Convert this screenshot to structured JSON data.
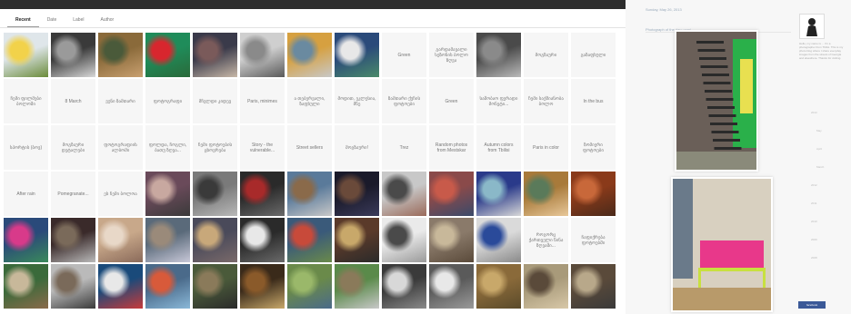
{
  "archive": {
    "tabs": [
      {
        "label": "Recent",
        "active": true
      },
      {
        "label": "Date",
        "active": false
      },
      {
        "label": "Label",
        "active": false
      },
      {
        "label": "Author",
        "active": false
      }
    ],
    "rows": [
      [
        {
          "kind": "photo",
          "colors": [
            "#dfe6ea",
            "#f2d24a",
            "#6b8c3a"
          ]
        },
        {
          "kind": "photo",
          "colors": [
            "#3a3a3a",
            "#9a9a9a",
            "#d8d8d8"
          ]
        },
        {
          "kind": "photo",
          "colors": [
            "#8a6a3a",
            "#4a5a3a",
            "#c9a070"
          ]
        },
        {
          "kind": "photo",
          "colors": [
            "#1f8c5a",
            "#d8262e",
            "#2a6a3a"
          ]
        },
        {
          "kind": "photo",
          "colors": [
            "#3a3a4a",
            "#7a5a5a",
            "#c8b8a8"
          ]
        },
        {
          "kind": "photo",
          "colors": [
            "#cfcfcf",
            "#8a8a8a",
            "#5a5a5a"
          ]
        },
        {
          "kind": "photo",
          "colors": [
            "#d6a040",
            "#6a8aa0",
            "#c8c8c8"
          ]
        },
        {
          "kind": "photo",
          "colors": [
            "#2a4a7a",
            "#e8e8e8",
            "#4a8a6a"
          ]
        },
        {
          "kind": "text",
          "text": "Green"
        },
        {
          "kind": "text",
          "text": "გარდამავალი სეზონის ბოლო ზღვა"
        },
        {
          "kind": "photo",
          "colors": [
            "#4a4a4a",
            "#8a8a8a",
            "#bababa"
          ]
        },
        {
          "kind": "text",
          "text": "მოგზაური"
        },
        {
          "kind": "text",
          "text": "გაზაფხული"
        }
      ],
      [
        {
          "kind": "text",
          "text": "ჩემი ფილმები ბოლოში"
        },
        {
          "kind": "text",
          "text": "8 March"
        },
        {
          "kind": "text",
          "text": "ვენი ზამთარი"
        },
        {
          "kind": "text",
          "text": "ფოტოგრაფი"
        },
        {
          "kind": "text",
          "text": "მჩვლდი კიდევ"
        },
        {
          "kind": "text",
          "text": "Paris, minimes"
        },
        {
          "kind": "text",
          "text": "ა თებერვალი, ზაფხული"
        },
        {
          "kind": "text",
          "text": "მოდით, ეკლესია, მწე"
        },
        {
          "kind": "text",
          "text": "ზამთარი ქუჩის ფოტოები"
        },
        {
          "kind": "text",
          "text": "Green"
        },
        {
          "kind": "text",
          "text": "საშობაო ფერადი მონეტი..."
        },
        {
          "kind": "text",
          "text": "ჩემი საქმიანობა ბოლო"
        },
        {
          "kind": "text",
          "text": "In the bus"
        }
      ],
      [
        {
          "kind": "text",
          "text": "სპორტის (ბოვ)"
        },
        {
          "kind": "text",
          "text": "მოგზაური დეტალები"
        },
        {
          "kind": "text",
          "text": "ფოტოგრაფიის ალბომი"
        },
        {
          "kind": "text",
          "text": "ფოლდა, ჩოგლი, ბათუ ზღვა..."
        },
        {
          "kind": "text",
          "text": "ჩემი ფოტოების ცხოვრება"
        },
        {
          "kind": "text",
          "text": "Story - the vulnerable..."
        },
        {
          "kind": "text",
          "text": "Street sellers"
        },
        {
          "kind": "text",
          "text": "მოგზაური!"
        },
        {
          "kind": "text",
          "text": "Trez"
        },
        {
          "kind": "text",
          "text": "Random photos from Mestskar"
        },
        {
          "kind": "text",
          "text": "Autumn colors from Tbilisi"
        },
        {
          "kind": "text",
          "text": "Paris in color"
        },
        {
          "kind": "text",
          "text": "ზომიერი ფოტოები"
        }
      ],
      [
        {
          "kind": "text",
          "text": "After rain"
        },
        {
          "kind": "text",
          "text": "Pomegranate..."
        },
        {
          "kind": "text",
          "text": "ეს ჩემი ბოლოა"
        },
        {
          "kind": "photo",
          "colors": [
            "#6a4a5a",
            "#c8a8a0",
            "#3a3a3a"
          ]
        },
        {
          "kind": "photo",
          "colors": [
            "#7a7a7a",
            "#3a3a3a",
            "#b8b8b8"
          ]
        },
        {
          "kind": "photo",
          "colors": [
            "#2a2a2a",
            "#a82a2a",
            "#6a6a6a"
          ]
        },
        {
          "kind": "photo",
          "colors": [
            "#5a7a9a",
            "#8a6a4a",
            "#c8c8c8"
          ]
        },
        {
          "kind": "photo",
          "colors": [
            "#1a1a2a",
            "#6a4a3a",
            "#3a3a5a"
          ]
        },
        {
          "kind": "photo",
          "colors": [
            "#c8c8c8",
            "#4a4a4a",
            "#9a6a5a"
          ]
        },
        {
          "kind": "photo",
          "colors": [
            "#8a4a4a",
            "#c85a4a",
            "#3a4a6a"
          ]
        },
        {
          "kind": "photo",
          "colors": [
            "#2a3a8a",
            "#8ab8c8",
            "#d8d8d8"
          ]
        },
        {
          "kind": "photo",
          "colors": [
            "#a87a3a",
            "#5a7a5a",
            "#e8c89a"
          ]
        },
        {
          "kind": "photo",
          "colors": [
            "#8a3a1a",
            "#c8683a",
            "#4a2a1a"
          ]
        }
      ],
      [
        {
          "kind": "photo",
          "colors": [
            "#2a4a7a",
            "#d83a8a",
            "#3a8a5a"
          ]
        },
        {
          "kind": "photo",
          "colors": [
            "#3a2a2a",
            "#7a6a5a",
            "#bababa"
          ]
        },
        {
          "kind": "photo",
          "colors": [
            "#c8a88a",
            "#e8d8c8",
            "#8a6a5a"
          ]
        },
        {
          "kind": "photo",
          "colors": [
            "#5a6a7a",
            "#9a8a7a",
            "#c8c8d8"
          ]
        },
        {
          "kind": "photo",
          "colors": [
            "#4a4a5a",
            "#c8a87a",
            "#7a6a6a"
          ]
        },
        {
          "kind": "photo",
          "colors": [
            "#2a2a2a",
            "#e8e8e8",
            "#6a6a6a"
          ]
        },
        {
          "kind": "photo",
          "colors": [
            "#3a5a7a",
            "#c84a3a",
            "#6a8a4a"
          ]
        },
        {
          "kind": "photo",
          "colors": [
            "#5a3a2a",
            "#c8a86a",
            "#2a2a2a"
          ]
        },
        {
          "kind": "photo",
          "colors": [
            "#eaeaea",
            "#4a4a4a",
            "#9a9a9a"
          ]
        },
        {
          "kind": "photo",
          "colors": [
            "#8a7a6a",
            "#c8b89a",
            "#5a4a3a"
          ]
        },
        {
          "kind": "photo",
          "colors": [
            "#dadada",
            "#2a4a9a",
            "#8a8a8a"
          ]
        },
        {
          "kind": "text",
          "text": "როგორც ქართველი წინა ზღვაში..."
        },
        {
          "kind": "text",
          "text": "ჩაფიქრება ფოტოებში"
        }
      ],
      [
        {
          "kind": "photo",
          "colors": [
            "#3a6a3a",
            "#c8b89a",
            "#8a6a4a"
          ]
        },
        {
          "kind": "photo",
          "colors": [
            "#bababa",
            "#7a6a5a",
            "#3a3a3a"
          ]
        },
        {
          "kind": "photo",
          "colors": [
            "#1a4a7a",
            "#e8e8e8",
            "#c83a3a"
          ]
        },
        {
          "kind": "photo",
          "colors": [
            "#4a6a8a",
            "#d85a3a",
            "#8ab8d8"
          ]
        },
        {
          "kind": "photo",
          "colors": [
            "#4a5a3a",
            "#8a7a5a",
            "#2a2a2a"
          ]
        },
        {
          "kind": "photo",
          "colors": [
            "#3a2a1a",
            "#8a5a2a",
            "#c8a86a"
          ]
        },
        {
          "kind": "photo",
          "colors": [
            "#6a8a4a",
            "#9ab86a",
            "#4a6a8a"
          ]
        },
        {
          "kind": "photo",
          "colors": [
            "#5a8a4a",
            "#8a7a5a",
            "#c8c8c8"
          ]
        },
        {
          "kind": "photo",
          "colors": [
            "#3a3a3a",
            "#d8d8d8",
            "#8a8a8a"
          ]
        },
        {
          "kind": "photo",
          "colors": [
            "#5a5a5a",
            "#e8e8e8",
            "#9a9a9a"
          ]
        },
        {
          "kind": "photo",
          "colors": [
            "#8a6a3a",
            "#c8a86a",
            "#5a4a2a"
          ]
        },
        {
          "kind": "photo",
          "colors": [
            "#a89a7a",
            "#5a4a3a",
            "#d8c8a8"
          ]
        },
        {
          "kind": "photo",
          "colors": [
            "#5a4a3a",
            "#b8a88a",
            "#3a3a3a"
          ]
        }
      ]
    ]
  },
  "blog": {
    "date": "Sunday, May 26, 2013",
    "post_title": "Photograph of the day: yomi...",
    "photos": [
      {
        "colors": [
          "#6a5f58",
          "#2ab04a",
          "#e8e050",
          "#2a2a2a"
        ]
      },
      {
        "colors": [
          "#6a7a8a",
          "#e8388a",
          "#c8e040",
          "#d8d0c0"
        ]
      }
    ],
    "profile_text": "Hello, my name is ... I'm a photographer from Tbilisi. This is my photo blog where I share everyday images from the streets of Georgia and elsewhere. Thanks for visiting.",
    "sidebar_links": [
      "2013",
      "May",
      "April",
      "March",
      "2012",
      "2011",
      "2010",
      "2009",
      "2008"
    ],
    "facebook_label": "facebook"
  }
}
